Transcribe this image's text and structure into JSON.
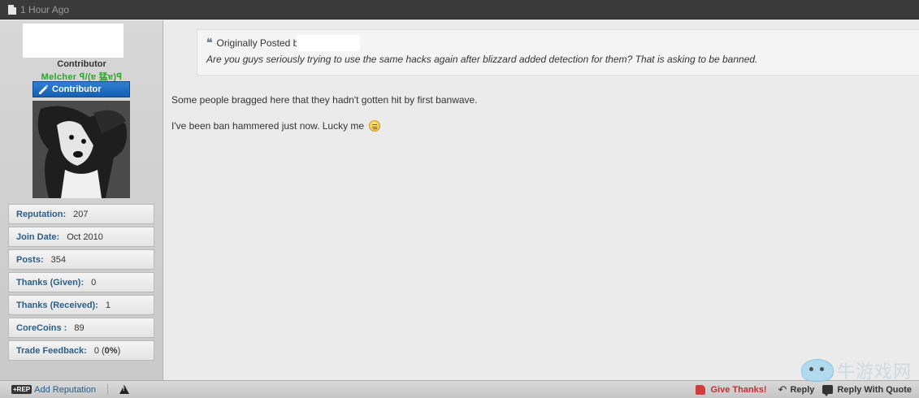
{
  "header": {
    "timestamp": "1 Hour Ago"
  },
  "user": {
    "title": "Contributor",
    "mirrored_name": "Melcher ꟼ/(ɐ 猛ɐ)ꟼ",
    "rank_badge": "Contributor",
    "stats": [
      {
        "label": "Reputation:",
        "value": "207"
      },
      {
        "label": "Join Date:",
        "value": "Oct 2010"
      },
      {
        "label": "Posts:",
        "value": "354"
      },
      {
        "label": "Thanks (Given):",
        "value": "0"
      },
      {
        "label": "Thanks (Received):",
        "value": "1"
      },
      {
        "label": "CoreCoins :",
        "value": "89"
      },
      {
        "label": "Trade Feedback:",
        "value": "0 (",
        "value_bold": "0%",
        "value_suffix": ")"
      }
    ]
  },
  "post": {
    "quote_header": "Originally Posted b",
    "quote_text": "Are you guys seriously trying to use the same hacks again after blizzard added detection for them? That is asking to be banned.",
    "paragraph1": "Some people bragged here that they hadn't gotten hit by first banwave.",
    "paragraph2": "I've been ban hammered just now. Lucky me"
  },
  "footer": {
    "add_reputation": "Add Reputation",
    "rep_badge": "+REP",
    "give_thanks": "Give Thanks!",
    "reply": "Reply",
    "reply_with_quote": "Reply With Quote"
  },
  "watermark": {
    "text": "牛游戏网"
  },
  "icons": [
    "document-icon",
    "pencil-icon",
    "quote-icon",
    "smiley-icon",
    "rep-icon",
    "warning-icon",
    "thumbs-up-icon",
    "reply-icon",
    "reply-quote-icon",
    "watermark-logo-icon"
  ],
  "colors": {
    "topbar": "#3a3a3a",
    "badge_blue": "#1f6fc4",
    "label_blue": "#2c5d86",
    "thanks_red": "#c62f2f",
    "green_name": "#2aa52a"
  }
}
